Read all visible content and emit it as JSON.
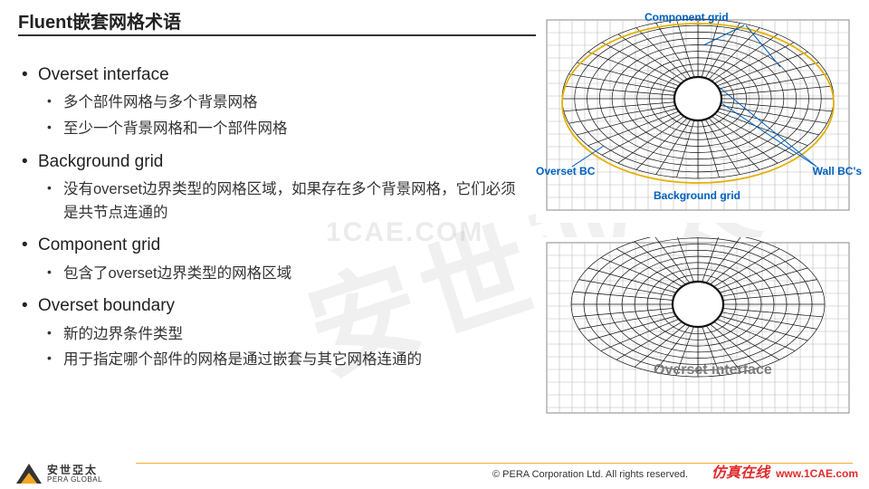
{
  "title": "Fluent嵌套网格术语",
  "bullets": {
    "b1": "Overset interface",
    "b1a": "多个部件网格与多个背景网格",
    "b1b": "至少一个背景网格和一个部件网格",
    "b2": "Background grid",
    "b2a": "没有overset边界类型的网格区域，如果存在多个背景网格，它们必须是共节点连通的",
    "b3": "Component grid",
    "b3a": "包含了overset边界类型的网格区域",
    "b4": "Overset boundary",
    "b4a": "新的边界条件类型",
    "b4b": "用于指定哪个部件的网格是通过嵌套与其它网格连通的"
  },
  "fig1": {
    "componentGrid": "Component grid",
    "oversetBC": "Overset BC",
    "wallBC": "Wall BC's",
    "backgroundGrid": "Background grid"
  },
  "fig2": {
    "oversetInterface": "Overset interface"
  },
  "watermark": {
    "big": "安世亚太",
    "url": "1CAE.COM"
  },
  "footer": {
    "logoCn": "安世亞太",
    "logoEn": "PERA GLOBAL",
    "copyright": "©  PERA Corporation Ltd. All rights reserved.",
    "redTag": "仿真在线",
    "redUrl": "www.1CAE.com"
  }
}
